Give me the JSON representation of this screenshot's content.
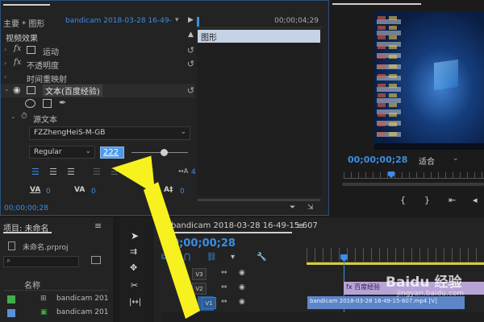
{
  "effect_controls": {
    "tab_label": "主要 * 图形",
    "source_label": "bandicam 2018-03-28 16-49-15-607...",
    "section_video_effects": "视频效果",
    "effects": [
      {
        "fx": "fx",
        "name": "运动"
      },
      {
        "fx": "fx",
        "name": "不透明度"
      },
      {
        "fx": "",
        "name": "时间重映射"
      }
    ],
    "text_layer": "文本(百度经验)",
    "source_text": "源文本",
    "font_name": "FZZhengHeiS-M-GB",
    "font_style": "Regular",
    "font_size": "222",
    "timecode_mini": "00;00;04;29",
    "clip_label": "图形",
    "footer_timecode": "00;00;00;28",
    "va_values": [
      "0",
      "0",
      "0"
    ],
    "tracking_value": "4"
  },
  "program_monitor": {
    "timecode": "00;00;00;28",
    "fit": "适合"
  },
  "project_panel": {
    "title": "项目: 未命名",
    "file": "未命名.prproj",
    "column_name": "名称",
    "items": [
      "bandicam 201",
      "bandicam 201"
    ],
    "colors": [
      "#3fae49",
      "#5b8fd6"
    ]
  },
  "timeline": {
    "tab_label": "bandicam 2018-03-28 16-49-15-607",
    "timecode": "00;00;00;28",
    "tracks": [
      "V3",
      "V2",
      "V1"
    ],
    "graphic_clip": "fx 百度经验",
    "video_clip": "bandicam 2018-03-28 16-49-15-607.mp4 [V]"
  },
  "watermark": {
    "brand": "Baidu 经验",
    "url": "jingyan.baidu.com"
  },
  "colors": {
    "accent": "#3b8de6",
    "arrow": "#f7f11f",
    "clip_purple": "#b8a3d6",
    "clip_blue": "#5d86c8",
    "playhead": "#3b8de6"
  }
}
